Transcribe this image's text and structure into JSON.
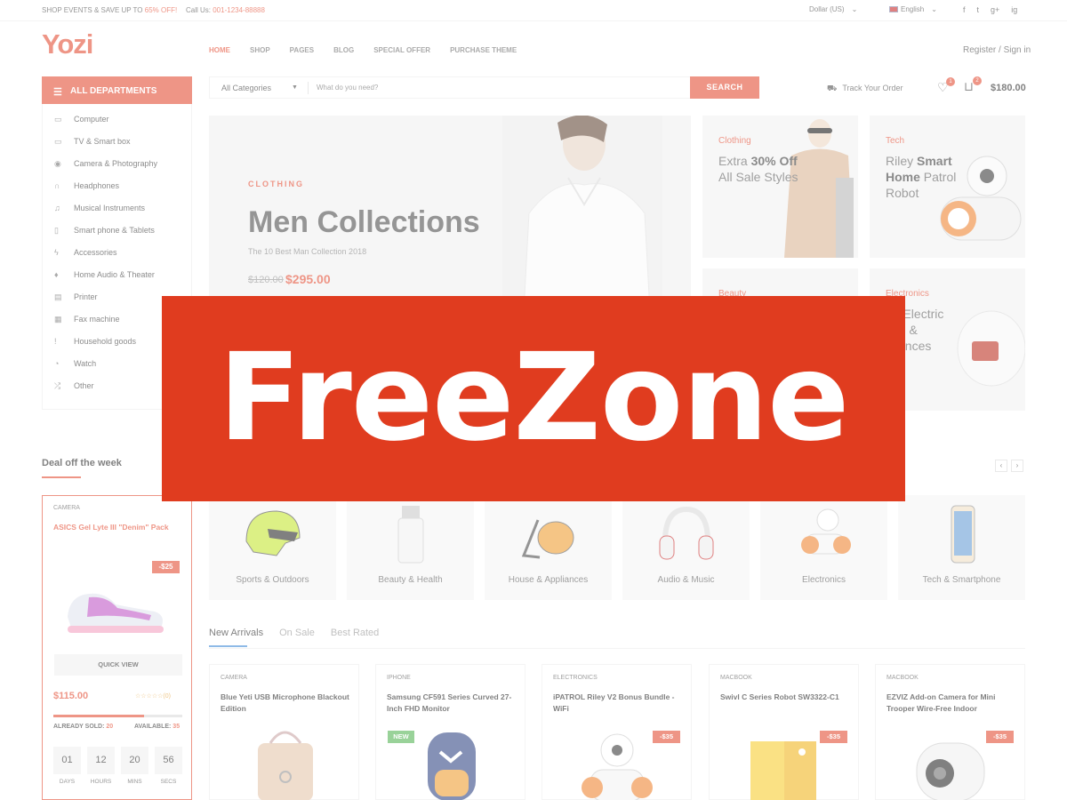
{
  "topbar": {
    "promo_text": "SHOP EVENTS & SAVE UP TO ",
    "promo_highlight": "65% OFF!",
    "call_label": "Call Us: ",
    "call_number": "001-1234-88888",
    "currency": "Dollar (US)",
    "language": "English",
    "socials": [
      "f",
      "t",
      "g+",
      "ig"
    ]
  },
  "header": {
    "logo": "Yozi",
    "nav": [
      "HOME",
      "SHOP",
      "PAGES",
      "BLOG",
      "SPECIAL OFFER",
      "PURCHASE THEME"
    ],
    "nav_active": "HOME",
    "register": "Register / Sign in"
  },
  "departments": {
    "title": "ALL DEPARTMENTS",
    "items": [
      {
        "label": "Computer",
        "icon": "laptop-icon"
      },
      {
        "label": "TV & Smart box",
        "icon": "tv-icon"
      },
      {
        "label": "Camera & Photography",
        "icon": "camera-icon"
      },
      {
        "label": "Headphones",
        "icon": "headphones-icon"
      },
      {
        "label": "Musical Instruments",
        "icon": "music-icon"
      },
      {
        "label": "Smart phone & Tablets",
        "icon": "phone-icon"
      },
      {
        "label": "Accessories",
        "icon": "bolt-icon"
      },
      {
        "label": "Home Audio & Theater",
        "icon": "mic-icon"
      },
      {
        "label": "Printer",
        "icon": "printer-icon"
      },
      {
        "label": "Fax machine",
        "icon": "fax-icon"
      },
      {
        "label": "Household goods",
        "icon": "torch-icon"
      },
      {
        "label": "Watch",
        "icon": "clock-icon"
      },
      {
        "label": "Other",
        "icon": "shuffle-icon"
      }
    ]
  },
  "search": {
    "category": "All Categories",
    "placeholder": "What do you need?",
    "button": "SEARCH"
  },
  "account": {
    "track": "Track Your Order",
    "wishlist_count": "1",
    "cart_count": "2",
    "cart_total": "$180.00"
  },
  "hero": {
    "kicker": "CLOTHING",
    "headline": "Men Collections",
    "subtitle": "The 10 Best Man Collection 2018",
    "old_price": "$120.00",
    "new_price": "$295.00"
  },
  "tiles": [
    {
      "category": "Clothing",
      "line1": "Extra ",
      "bold1": "30%",
      "line2": "Off",
      "rest": " All Sale Styles"
    },
    {
      "category": "Tech",
      "line1": "Riley ",
      "bold1": "Smart Home",
      "line2": "",
      "rest": " Patrol Robot"
    },
    {
      "category": "Beauty",
      "line1": "",
      "bold1": "",
      "line2": "",
      "rest": ""
    },
    {
      "category": "Electronics",
      "line1": "",
      "bold1": "",
      "line2": "",
      "rest": "be Electric use & pliances"
    }
  ],
  "overlay": {
    "text": "FreeZone"
  },
  "deal": {
    "title": "Deal off the week",
    "category": "CAMERA",
    "name": "ASICS Gel Lyte III \"Denim\" Pack",
    "discount": "-$25",
    "quick_view": "QUICK VIEW",
    "price": "$115.00",
    "rating_count": "(0)",
    "sold_label": "ALREADY SOLD: ",
    "sold": "20",
    "available_label": "AVAILABLE: ",
    "available": "35",
    "sold_fraction": 0.7,
    "timer": [
      {
        "value": "01",
        "label": "DAYS"
      },
      {
        "value": "12",
        "label": "HOURS"
      },
      {
        "value": "20",
        "label": "MINS"
      },
      {
        "value": "56",
        "label": "SECS"
      }
    ]
  },
  "categories": [
    "Sports & Outdoors",
    "Beauty & Health",
    "House & Appliances",
    "Audio & Music",
    "Electronics",
    "Tech & Smartphone"
  ],
  "product_tabs": [
    "New Arrivals",
    "On Sale",
    "Best Rated"
  ],
  "products": [
    {
      "category": "CAMERA",
      "name": "Blue Yeti USB Microphone Blackout Edition",
      "tag": ""
    },
    {
      "category": "IPHONE",
      "name": "Samsung CF591 Series Curved 27-Inch FHD Monitor",
      "tag": "NEW"
    },
    {
      "category": "ELECTRONICS",
      "name": "iPATROL Riley V2 Bonus Bundle - WiFi",
      "tag": "-$35"
    },
    {
      "category": "MACBOOK",
      "name": "Swivl C Series Robot SW3322-C1",
      "tag": "-$35"
    },
    {
      "category": "MACBOOK",
      "name": "EZVIZ Add-on Camera for Mini Trooper Wire-Free Indoor",
      "tag": "-$35"
    }
  ],
  "colors": {
    "accent": "#e5553d",
    "overlay": "#e03c1f",
    "tab_active": "#4a90d9"
  }
}
